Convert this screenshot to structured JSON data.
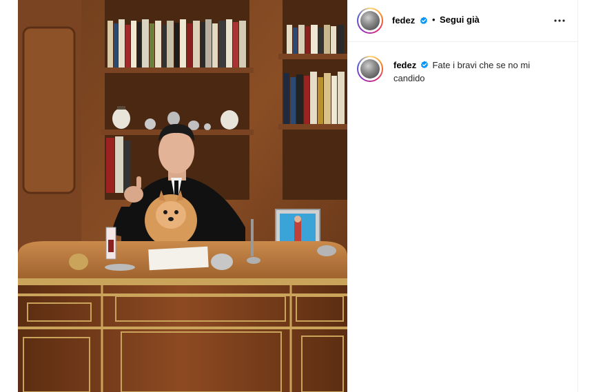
{
  "post": {
    "author": {
      "username": "fedez",
      "verified": true
    },
    "follow_label": "Segui già",
    "separator": "•",
    "caption": {
      "username": "fedez",
      "text": "Fate i bravi che se no mi candido"
    }
  },
  "icons": {
    "verified": "verified-badge-icon",
    "more": "more-options-icon"
  },
  "colors": {
    "verified": "#0095f6",
    "story_ring": [
      "#feda75",
      "#fa7e1e",
      "#d62976",
      "#962fbf",
      "#4f5bd5"
    ],
    "divider": "#efefef"
  }
}
